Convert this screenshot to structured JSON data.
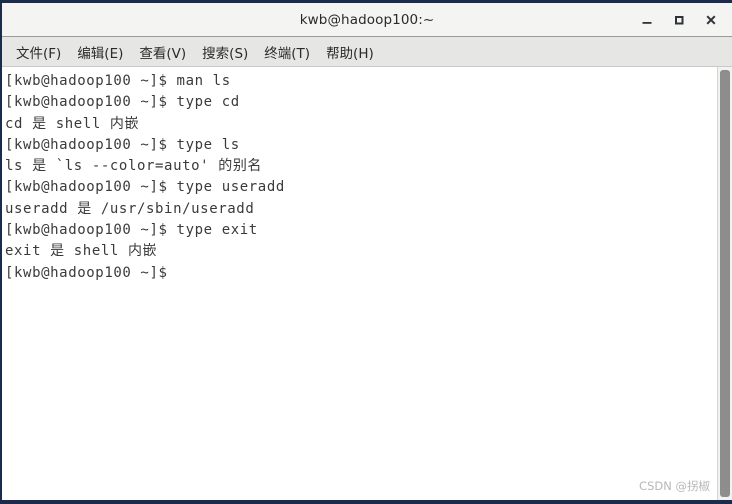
{
  "window": {
    "title": "kwb@hadoop100:~",
    "controls": [
      {
        "name": "minimize-button",
        "label": "_"
      },
      {
        "name": "maximize-button",
        "label": "□"
      },
      {
        "name": "close-button",
        "label": "✕"
      }
    ]
  },
  "menubar": {
    "items": [
      {
        "label": "文件(F)"
      },
      {
        "label": "编辑(E)"
      },
      {
        "label": "查看(V)"
      },
      {
        "label": "搜索(S)"
      },
      {
        "label": "终端(T)"
      },
      {
        "label": "帮助(H)"
      }
    ]
  },
  "terminal": {
    "prompt": "[kwb@hadoop100 ~]$",
    "lines": [
      "[kwb@hadoop100 ~]$ man ls",
      "[kwb@hadoop100 ~]$ type cd",
      "cd 是 shell 内嵌",
      "[kwb@hadoop100 ~]$ type ls",
      "ls 是 `ls --color=auto' 的别名",
      "[kwb@hadoop100 ~]$ type useradd",
      "useradd 是 /usr/sbin/useradd",
      "[kwb@hadoop100 ~]$ type exit",
      "exit 是 shell 内嵌",
      "[kwb@hadoop100 ~]$ "
    ],
    "foreground_color": "#3a3a3a",
    "background_color": "#ffffff"
  },
  "watermark": {
    "text": "CSDN @拐椒"
  }
}
